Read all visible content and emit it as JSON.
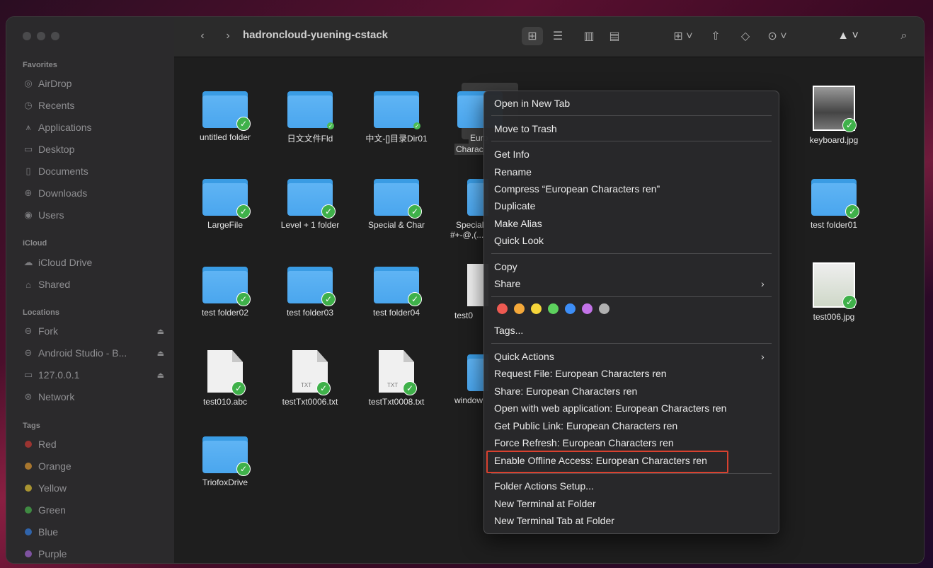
{
  "window": {
    "title": "hadroncloud-yuening-cstack"
  },
  "sidebar": {
    "favorites_header": "Favorites",
    "favorites": [
      {
        "label": "AirDrop",
        "icon": "airdrop-icon"
      },
      {
        "label": "Recents",
        "icon": "clock-icon"
      },
      {
        "label": "Applications",
        "icon": "applications-icon"
      },
      {
        "label": "Desktop",
        "icon": "desktop-icon"
      },
      {
        "label": "Documents",
        "icon": "document-icon"
      },
      {
        "label": "Downloads",
        "icon": "download-icon"
      },
      {
        "label": "Users",
        "icon": "user-icon"
      }
    ],
    "icloud_header": "iCloud",
    "icloud": [
      {
        "label": "iCloud Drive",
        "icon": "cloud-icon"
      },
      {
        "label": "Shared",
        "icon": "shared-folder-icon"
      }
    ],
    "locations_header": "Locations",
    "locations": [
      {
        "label": "Fork",
        "icon": "drive-icon"
      },
      {
        "label": "Android Studio - B...",
        "icon": "drive-icon"
      },
      {
        "label": "127.0.0.1",
        "icon": "monitor-icon"
      },
      {
        "label": "Network",
        "icon": "network-icon"
      }
    ],
    "tags_header": "Tags",
    "tags": [
      {
        "label": "Red",
        "color": "#e0443e"
      },
      {
        "label": "Orange",
        "color": "#f2a33a"
      },
      {
        "label": "Yellow",
        "color": "#f5d63d"
      },
      {
        "label": "Green",
        "color": "#56c25a"
      },
      {
        "label": "Blue",
        "color": "#3c8ef5"
      },
      {
        "label": "Purple",
        "color": "#b56de0"
      }
    ]
  },
  "files": [
    {
      "label": "untitled folder"
    },
    {
      "label": "日文文件Fld"
    },
    {
      "label": "中文-[]目录Dir01"
    },
    {
      "label": "Euro",
      "label2": "Charac"
    },
    {
      "label": "keyboard.jpg"
    },
    {
      "label": "LargeFile"
    },
    {
      "label": "Level + 1 folder"
    },
    {
      "label": "Special & Char"
    },
    {
      "label": "Special",
      "label2": "#+-@,(..."
    },
    {
      "label": "test folder01"
    },
    {
      "label": "test folder02"
    },
    {
      "label": "test folder03"
    },
    {
      "label": "test folder04"
    },
    {
      "label": "test0"
    },
    {
      "label": "test006.jpg"
    },
    {
      "label": "test010.abc"
    },
    {
      "label": "testTxt0006.txt",
      "ext": "TXT"
    },
    {
      "label": "testTxt0008.txt",
      "ext": "TXT"
    },
    {
      "label": "window"
    },
    {
      "label": "TriofoxDrive"
    }
  ],
  "menu": {
    "items": [
      "Open in New Tab",
      "Move to Trash",
      "Get Info",
      "Rename",
      "Compress “European Characters ren”",
      "Duplicate",
      "Make Alias",
      "Quick Look",
      "Copy",
      "Share",
      "Tags...",
      "Quick Actions",
      "Request File: European Characters ren",
      "Share: European Characters ren",
      "Open with web application: European Characters ren",
      "Get Public Link: European Characters ren",
      "Force Refresh: European Characters ren",
      "Enable Offline Access: European Characters ren",
      "Folder Actions Setup...",
      "New Terminal at Folder",
      "New Terminal Tab at Folder"
    ],
    "tag_colors": [
      "#ee5a52",
      "#f4a83a",
      "#f5d53a",
      "#5dd15e",
      "#3d8ef7",
      "#c373e8",
      "#b0b0b0"
    ]
  }
}
